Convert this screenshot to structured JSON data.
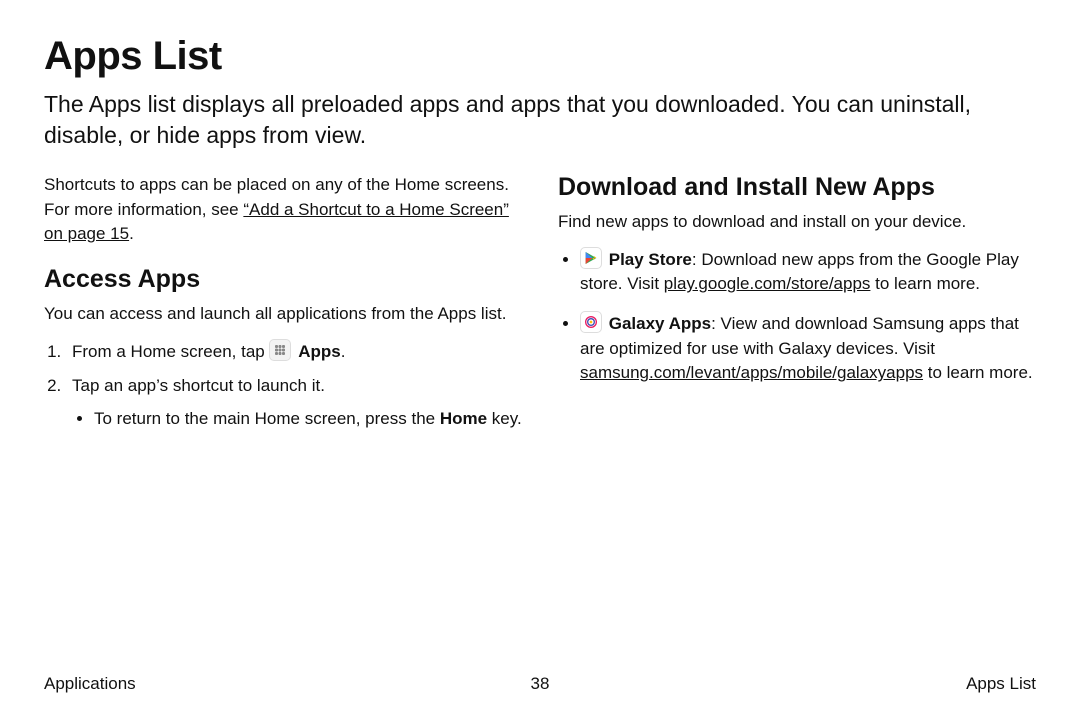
{
  "title": "Apps List",
  "intro": "The Apps list displays all preloaded apps and apps that you downloaded. You can uninstall, disable, or hide apps from view.",
  "left": {
    "shortcuts_pre": "Shortcuts to apps can be placed on any of the Home screens. For more information, see ",
    "shortcuts_link": "“Add a Shortcut to a Home Screen” on page 15",
    "shortcuts_post": ".",
    "access_heading": "Access Apps",
    "access_lead": "You can access and launch all applications from the Apps list.",
    "step1_pre": "From a Home screen, tap ",
    "step1_bold": "Apps",
    "step1_post": ".",
    "step2": "Tap an app’s shortcut to launch it.",
    "step2_sub_pre": "To return to the main Home screen, press the ",
    "step2_sub_bold": "Home",
    "step2_sub_post": " key."
  },
  "right": {
    "download_heading": "Download and Install New Apps",
    "download_lead": "Find new apps to download and install on your device.",
    "play_label": "Play Store",
    "play_text_pre": ": Download new apps from the Google Play store. Visit ",
    "play_link": "play.google.com/store/apps",
    "play_text_post": " to learn more.",
    "galaxy_label": "Galaxy Apps",
    "galaxy_text_pre": ": View and download Samsung apps that are optimized for use with Galaxy devices. Visit ",
    "galaxy_link": "samsung.com/levant/apps/mobile/galaxyapps",
    "galaxy_text_post": " to learn more."
  },
  "footer": {
    "left": "Applications",
    "center": "38",
    "right": "Apps List"
  }
}
